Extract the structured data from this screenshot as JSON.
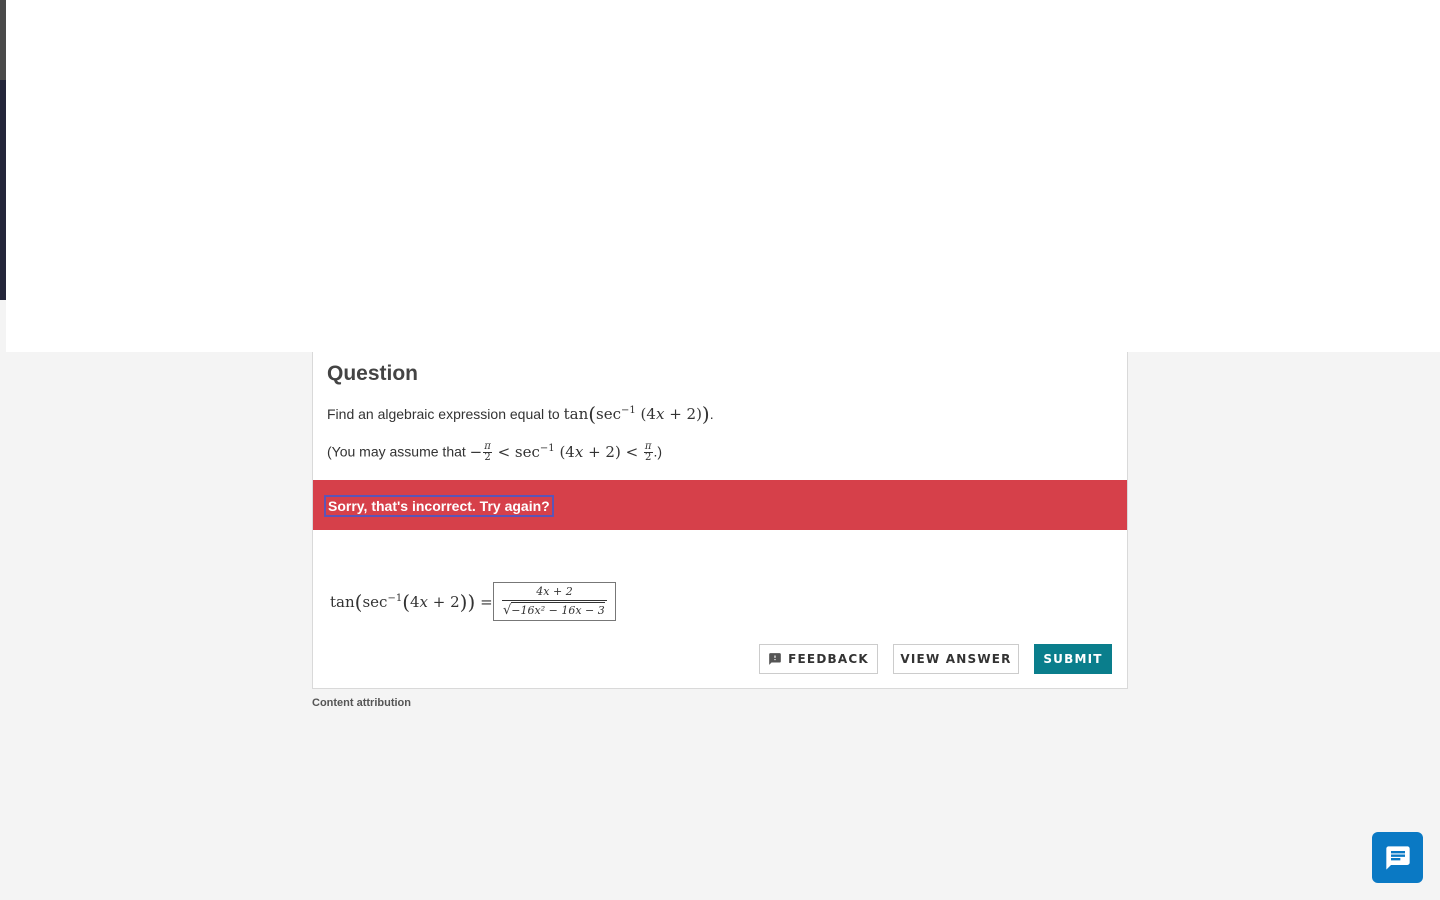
{
  "question": {
    "heading": "Question",
    "prompt_text": "Find an algebraic expression equal to ",
    "prompt_math": "tan(sec⁻¹ (4x + 2))",
    "prompt_end": ".",
    "assume_text": "(You may assume that ",
    "assume_end": ".)",
    "pi_symbol": "π",
    "two": "2"
  },
  "status": {
    "message": "Sorry, that's incorrect. Try again?",
    "color": "#d6404a"
  },
  "answer": {
    "lhs": "tan(sec⁻¹(4x + 2)) =",
    "numerator": "4x + 2",
    "denominator_radicand": "−16x² − 16x − 3"
  },
  "buttons": {
    "feedback": "FEEDBACK",
    "view_answer": "VIEW ANSWER",
    "submit": "SUBMIT",
    "submit_color": "#0a7e8c"
  },
  "footer": {
    "attribution": "Content attribution"
  },
  "icons": {
    "feedback": "feedback-icon",
    "chat": "chat-icon"
  }
}
